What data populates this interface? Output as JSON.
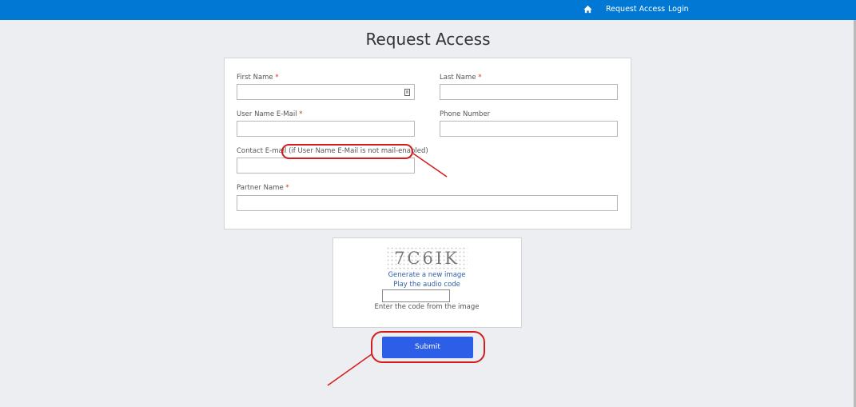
{
  "header": {
    "nav": {
      "home_icon": "home-icon",
      "request_access": "Request Access",
      "login": "Login"
    },
    "color": "#0078d4"
  },
  "page_title": "Request Access",
  "form": {
    "first_name": {
      "label": "First Name",
      "required": "*",
      "value": ""
    },
    "last_name": {
      "label": "Last Name",
      "required": "*",
      "value": ""
    },
    "user_email": {
      "label": "User Name E-Mail",
      "required": "*",
      "value": ""
    },
    "phone": {
      "label": "Phone Number",
      "value": ""
    },
    "contact_email": {
      "label": "Contact E-mail",
      "note": "(if User Name E-Mail is not mail-enabled)",
      "value": ""
    },
    "partner_name": {
      "label": "Partner Name",
      "required": "*",
      "value": ""
    }
  },
  "captcha": {
    "code_image_text": "7C6IK",
    "new_image": "Generate a new image",
    "audio": "Play the audio code",
    "value": "",
    "hint": "Enter the code from the image"
  },
  "submit_label": "Submit",
  "annotation_color": "#d41c1c"
}
